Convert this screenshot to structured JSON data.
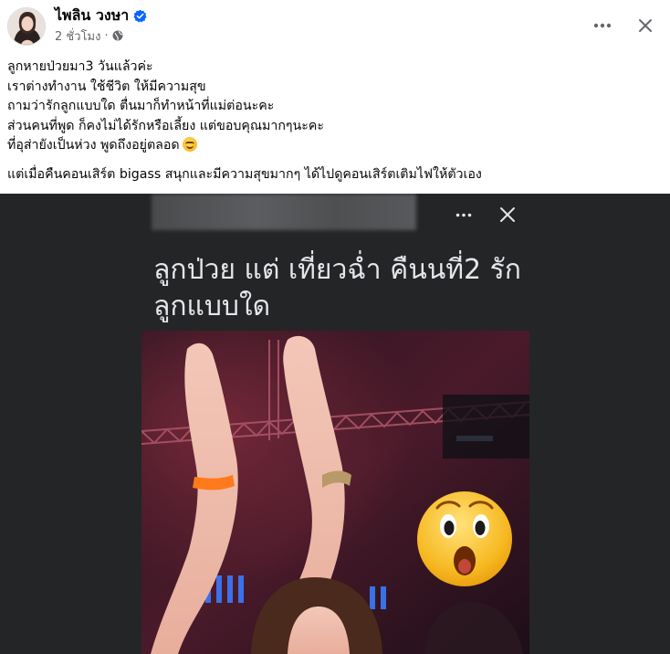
{
  "post": {
    "author_name": "ไพลิน วงษา",
    "timestamp": "2 ชั่วโมง",
    "meta_separator": "·",
    "privacy_icon": "globe-icon",
    "verified_icon": "verified-badge-icon",
    "more_icon": "more-horizontal-icon",
    "close_icon": "close-icon"
  },
  "caption": {
    "lines": [
      "ลูกหายป่วยมา3 วันแล้วค่ะ",
      "เราต่างทำงาน ใช้ชีวิต ให้มีความสุข",
      "ถามว่ารักลูกแบบใด ตื่นมาก็ทำหน้าที่แม่ต่อนะคะ",
      "ส่วนคนที่พูด ก็คงไม่ได้รักหรือเลี้ยง แต่ขอบคุณมากๆนะคะ",
      "ที่อุส่ายังเป็นห่วง พูดถึงอยู่ตลอด"
    ],
    "line_emoji_icon": "smiling-face-icon",
    "second_paragraph": "แต่เมื่อคืนคอนเสิร์ต bigass สนุกและมีความสุขมากๆ ได้ไปดูคอนเสิร์ตเติมไฟให้ตัวเอง"
  },
  "media": {
    "screenshot_title": "ลูกป่วย แต่ เที่ยวฉ่ำ คืนนที่2 รัก ลูกแบบใด",
    "more_icon": "more-horizontal-icon",
    "close_icon": "close-icon",
    "overlay_emoji_icon": "surprised-face-emoji-icon"
  },
  "colors": {
    "verified_blue": "#0866ff",
    "text_primary": "#050505",
    "text_secondary": "#65676b",
    "media_bg": "#242526",
    "media_title": "#e4e6eb"
  }
}
